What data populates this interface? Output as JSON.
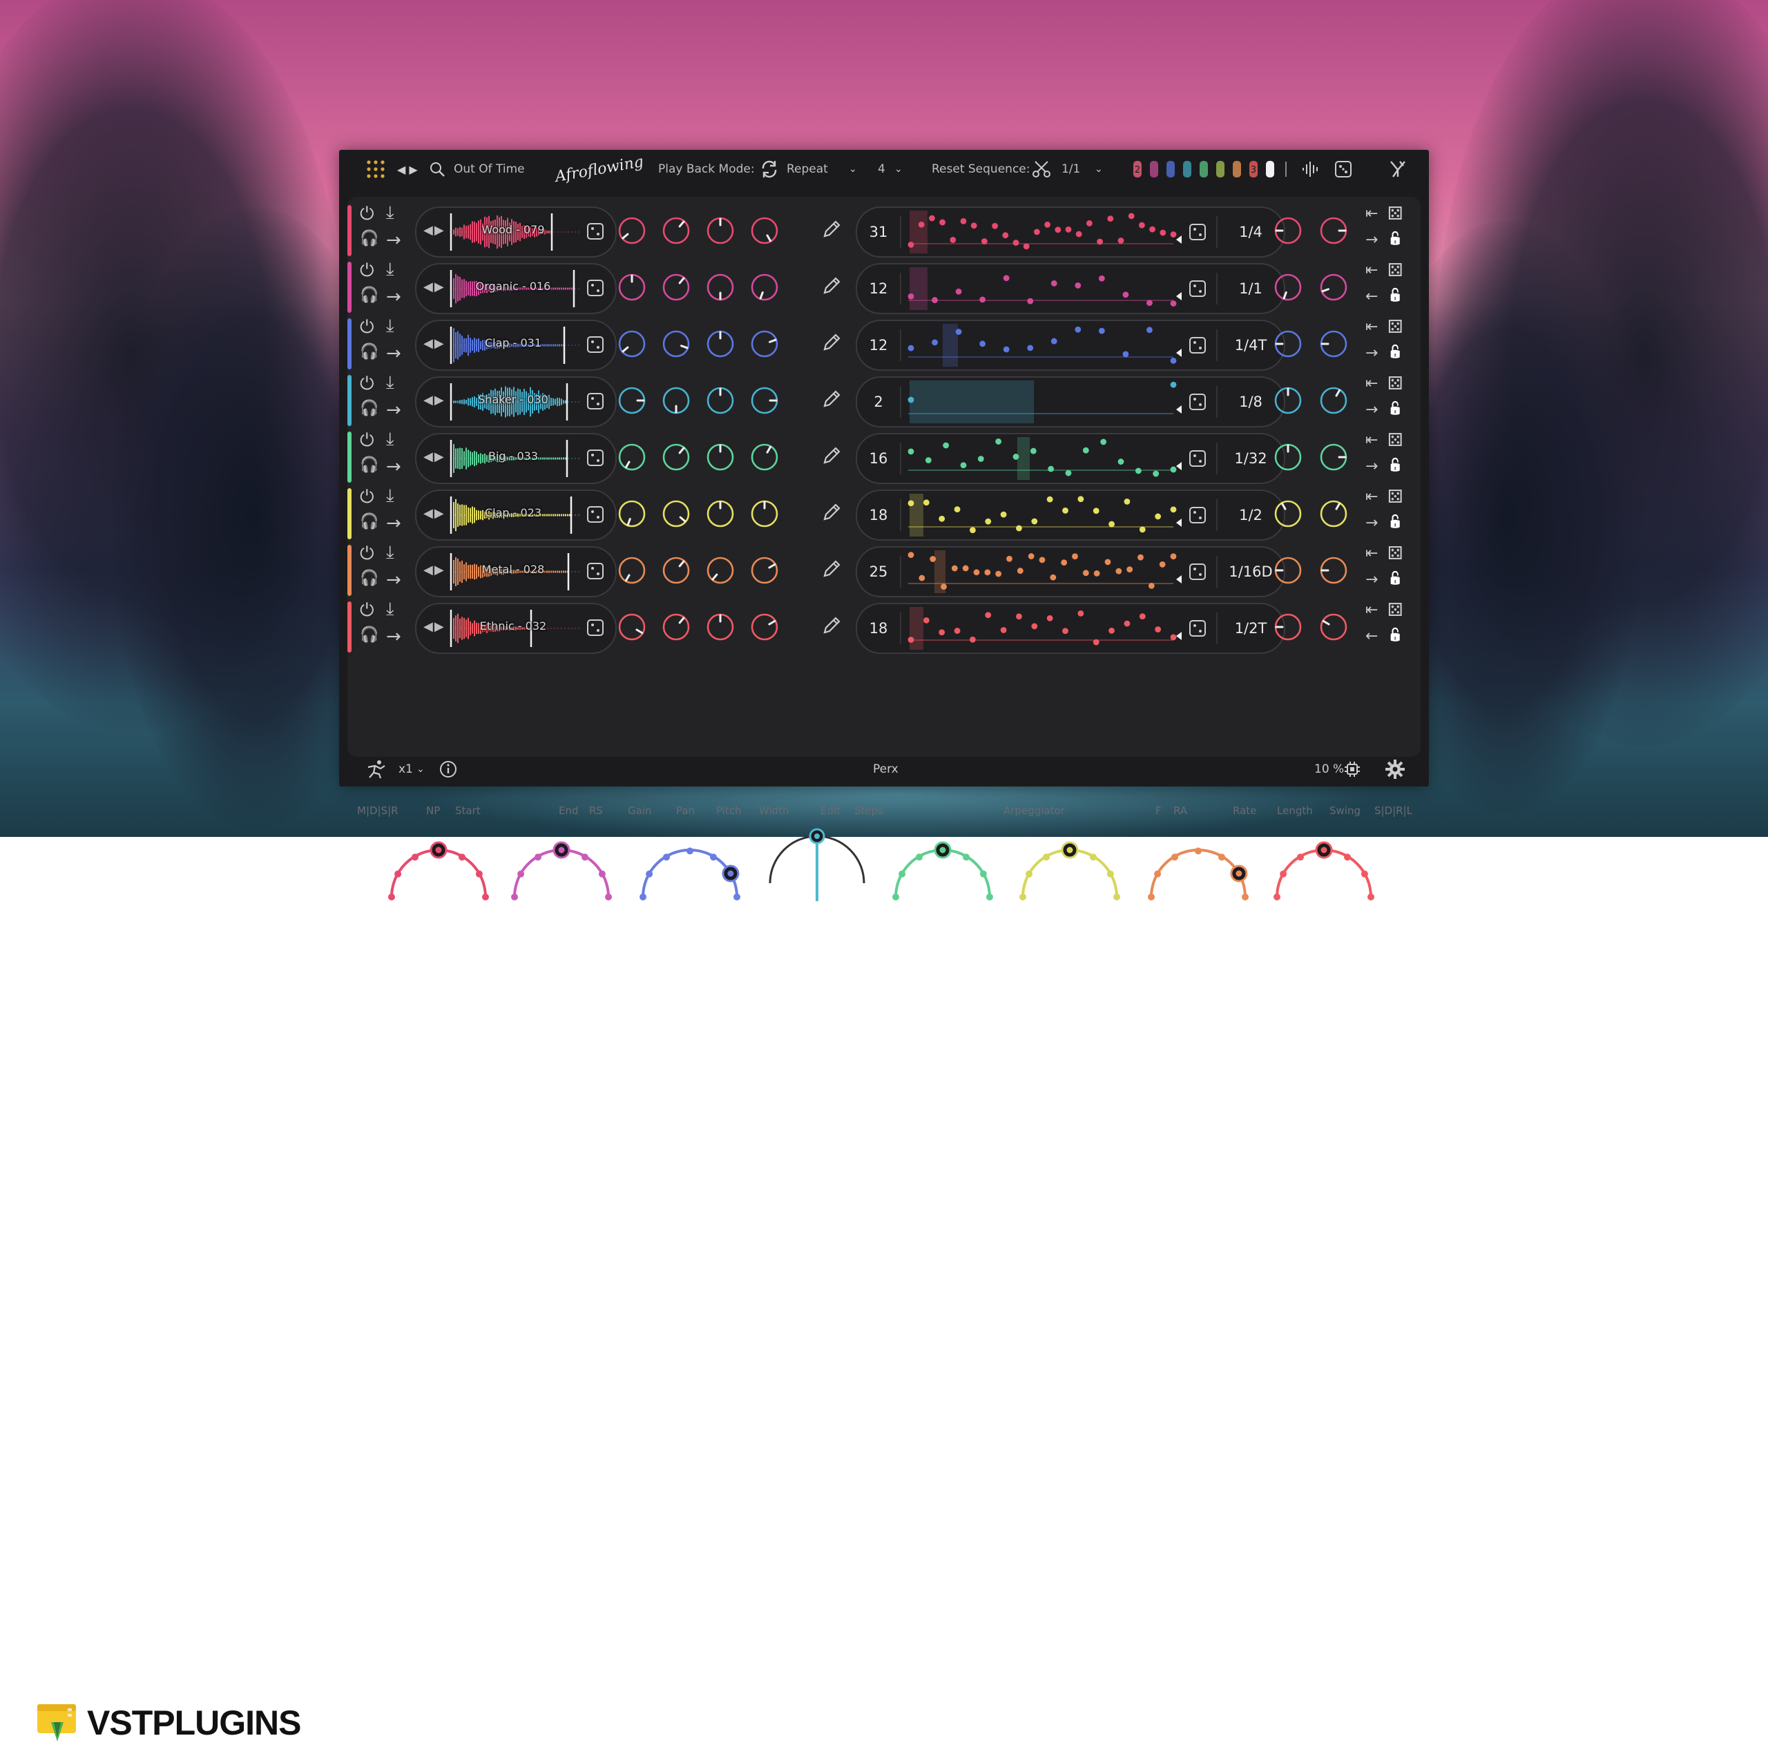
{
  "app": {
    "preset_name": "Out Of Time",
    "brand_signature": "Afroflowing",
    "playback_label": "Play Back Mode:",
    "playback_value": "Repeat",
    "count_value": "4",
    "reset_label": "Reset Sequence:",
    "reset_value": "1/1",
    "bottom_title": "Perx",
    "speed": "x1",
    "cpu": "10 %"
  },
  "footer": {
    "logo_text": "VSTPLUGINS"
  },
  "pattern_slots": [
    {
      "label": "2",
      "color": "#e05a78"
    },
    {
      "label": "",
      "color": "#b0478a"
    },
    {
      "label": "",
      "color": "#4e6bc9"
    },
    {
      "label": "",
      "color": "#3e97a9"
    },
    {
      "label": "",
      "color": "#54b07a"
    },
    {
      "label": "",
      "color": "#96b14e"
    },
    {
      "label": "",
      "color": "#d5894c"
    },
    {
      "label": "3",
      "color": "#e05a58"
    },
    {
      "label": "",
      "color": "#f2f2f2"
    }
  ],
  "tracks": [
    {
      "sample": "Wood - 079",
      "steps": "31",
      "rate": "1/4",
      "color": "#e84a6e",
      "lr_arrow": "right"
    },
    {
      "sample": "Organic - 016",
      "steps": "12",
      "rate": "1/1",
      "color": "#d44a9a",
      "lr_arrow": "left"
    },
    {
      "sample": "Clap - 031",
      "steps": "12",
      "rate": "1/4T",
      "color": "#5b77e0",
      "lr_arrow": "right"
    },
    {
      "sample": "Shaker - 030",
      "steps": "2",
      "rate": "1/8",
      "color": "#47b3d0",
      "lr_arrow": "right"
    },
    {
      "sample": "Big - 033",
      "steps": "16",
      "rate": "1/32",
      "color": "#5ed49a",
      "lr_arrow": "right"
    },
    {
      "sample": "Clap - 023",
      "steps": "18",
      "rate": "1/2",
      "color": "#e6e060",
      "lr_arrow": "right"
    },
    {
      "sample": "Metal - 028",
      "steps": "25",
      "rate": "1/16D",
      "color": "#e88a55",
      "lr_arrow": "right"
    },
    {
      "sample": "Ethnic - 032",
      "steps": "18",
      "rate": "1/2T",
      "color": "#ef5a62",
      "lr_arrow": "left"
    }
  ],
  "labels": {
    "mdsr": "M|D|S|R",
    "np": "NP",
    "start": "Start",
    "end": "End",
    "rs": "RS",
    "gain": "Gain",
    "pan": "Pan",
    "pitch": "Pitch",
    "width": "Width",
    "edit": "Edit",
    "steps": "Steps",
    "arpeggiator": "Arpeggiator",
    "f": "F",
    "ra": "RA",
    "rate": "Rate",
    "length": "Length",
    "swing": "Swing",
    "sdrl": "S|D|R|L"
  },
  "macros": [
    {
      "color": "#e84a6e"
    },
    {
      "color": "#c95bb8"
    },
    {
      "color": "#6a7de2"
    },
    {
      "color": "#4fb9cf"
    },
    {
      "color": "#5fcf8f"
    },
    {
      "color": "#d6d65a"
    },
    {
      "color": "#e88a55"
    },
    {
      "color": "#ef5a62"
    }
  ]
}
